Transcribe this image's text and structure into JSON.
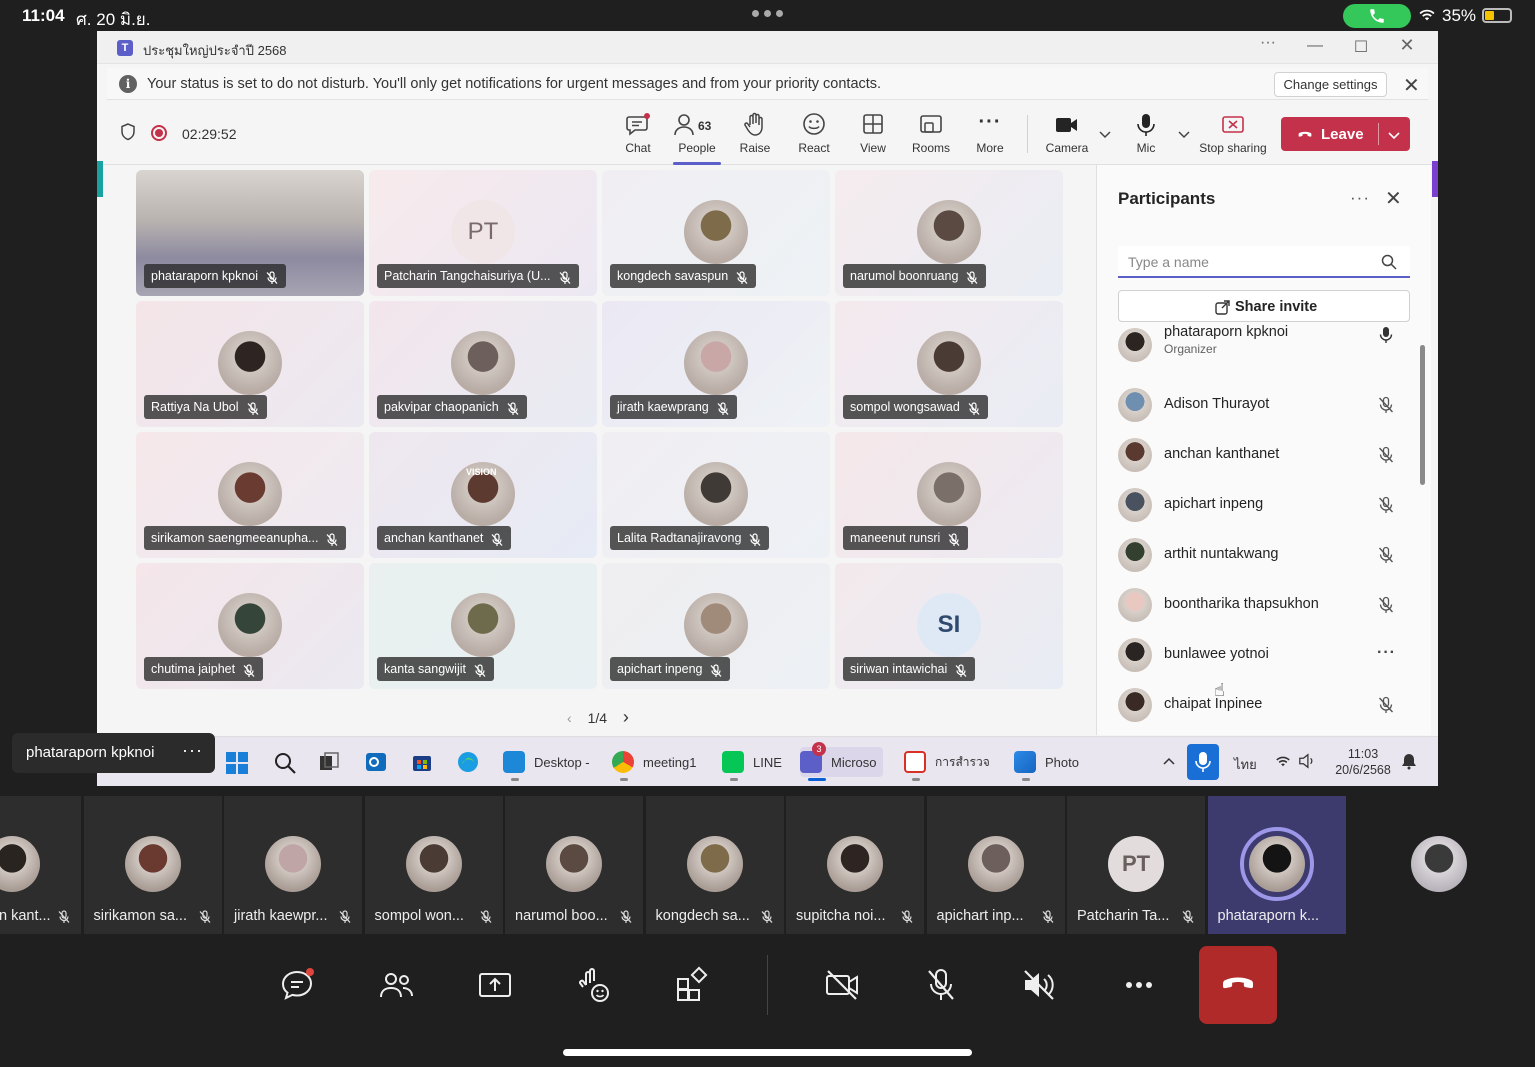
{
  "ios": {
    "time": "11:04",
    "date": "ศ. 20 มิ.ย.",
    "battery": "35%"
  },
  "window": {
    "title": "ประชุมใหญ่ประจำปี 2568",
    "dnd_message": "Your status is set to do not disturb. You'll only get notifications for urgent messages and from your priority contacts.",
    "change_settings": "Change settings"
  },
  "toolbar": {
    "timer": "02:29:52",
    "chat": "Chat",
    "people": "People",
    "people_count": "63",
    "raise": "Raise",
    "react": "React",
    "view": "View",
    "rooms": "Rooms",
    "more": "More",
    "camera": "Camera",
    "mic": "Mic",
    "stop_sharing": "Stop sharing",
    "leave": "Leave"
  },
  "gallery": {
    "tiles": [
      {
        "name": "phataraporn kpknoi"
      },
      {
        "name": "Patcharin Tangchaisuriya (U...",
        "initials": "PT"
      },
      {
        "name": "kongdech savaspun"
      },
      {
        "name": "narumol boonruang"
      },
      {
        "name": "Rattiya Na Ubol"
      },
      {
        "name": "pakvipar chaopanich"
      },
      {
        "name": "jirath kaewprang"
      },
      {
        "name": "sompol wongsawad"
      },
      {
        "name": "sirikamon saengmeeanupha..."
      },
      {
        "name": "anchan kanthanet",
        "tag": "VISION"
      },
      {
        "name": "Lalita Radtanajiravong"
      },
      {
        "name": "maneenut runsri"
      },
      {
        "name": "chutima jaiphet"
      },
      {
        "name": "kanta sangwijit"
      },
      {
        "name": "apichart inpeng"
      },
      {
        "name": "siriwan intawichai",
        "initials": "SI"
      }
    ],
    "pager": "1/4"
  },
  "panel": {
    "title": "Participants",
    "search_placeholder": "Type a name",
    "share_invite": "Share invite",
    "participants": [
      {
        "name": "phataraporn kpknoi",
        "role": "Organizer",
        "state": "mic-on"
      },
      {
        "name": "Adison Thurayot",
        "state": "muted"
      },
      {
        "name": "anchan kanthanet",
        "state": "muted"
      },
      {
        "name": "apichart inpeng",
        "state": "muted"
      },
      {
        "name": "arthit nuntakwang",
        "state": "muted"
      },
      {
        "name": "boontharika thapsukhon",
        "state": "muted"
      },
      {
        "name": "bunlawee yotnoi",
        "state": "more"
      },
      {
        "name": "chaipat Inpinee",
        "state": "muted"
      }
    ]
  },
  "taskbar": {
    "apps": [
      {
        "label": "Desktop -"
      },
      {
        "label": "meeting1"
      },
      {
        "label": "LINE"
      },
      {
        "label": "Microso",
        "badge": "3"
      },
      {
        "label": "การสำรวจ"
      },
      {
        "label": "Photo"
      }
    ],
    "lang": "ไทย",
    "time": "11:03",
    "date": "20/6/2568"
  },
  "self_label": "phataraporn kpknoi",
  "strip": {
    "tiles": [
      {
        "name": "n kant..."
      },
      {
        "name": "sirikamon sa..."
      },
      {
        "name": "jirath kaewpr..."
      },
      {
        "name": "sompol won..."
      },
      {
        "name": "narumol boo..."
      },
      {
        "name": "kongdech sa..."
      },
      {
        "name": "supitcha noi..."
      },
      {
        "name": "apichart inp..."
      },
      {
        "name": "Patcharin Ta...",
        "initials": "PT"
      },
      {
        "name": "phataraporn k..."
      }
    ]
  },
  "colors": {
    "accent": "#5b5fc7",
    "leave": "#c4314b",
    "hangup": "#b02a2a"
  }
}
